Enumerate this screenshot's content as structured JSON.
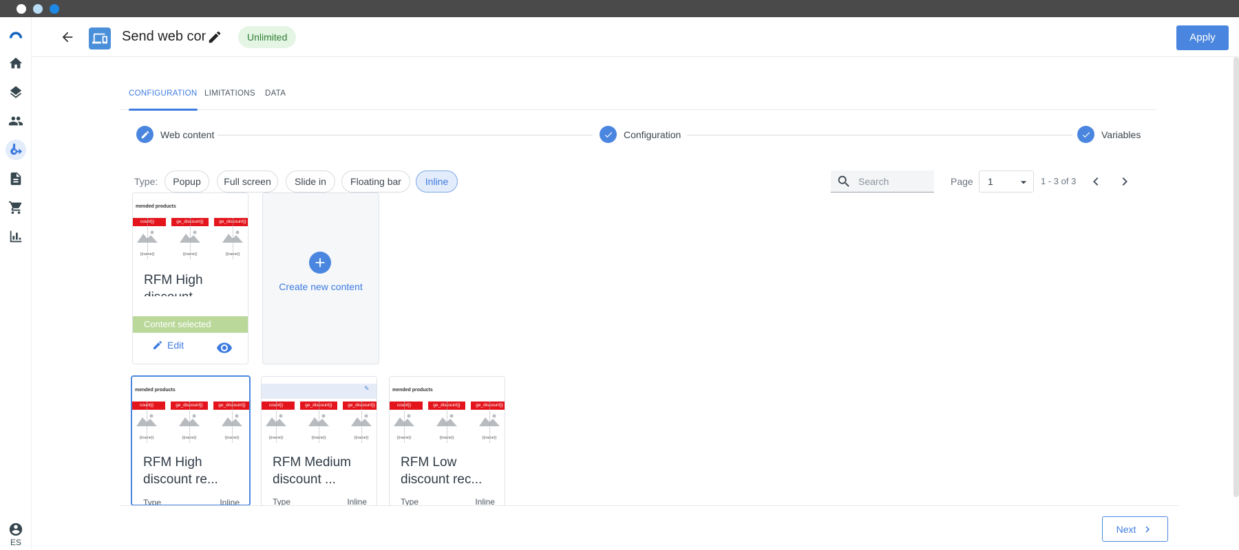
{
  "window": {
    "controls": [
      "close",
      "minimize",
      "maximize"
    ]
  },
  "rail": {
    "items": [
      {
        "icon": "logo-arc-icon"
      },
      {
        "icon": "home-icon"
      },
      {
        "icon": "layers-icon"
      },
      {
        "icon": "people-icon"
      },
      {
        "icon": "flow-branch-icon",
        "active": true
      },
      {
        "icon": "document-icon"
      },
      {
        "icon": "cart-icon"
      },
      {
        "icon": "bar-chart-icon"
      }
    ],
    "user_icon": "account-circle-icon",
    "language": "ES"
  },
  "header": {
    "title": "Send web content",
    "badge": "Unlimited",
    "apply_label": "Apply"
  },
  "tabs": [
    {
      "label": "CONFIGURATION",
      "active": true
    },
    {
      "label": "LIMITATIONS",
      "active": false
    },
    {
      "label": "DATA",
      "active": false
    }
  ],
  "stepper": {
    "steps": [
      {
        "label": "Web content",
        "icon": "pencil-icon"
      },
      {
        "label": "Configuration",
        "icon": "check-icon"
      },
      {
        "label": "Variables",
        "icon": "check-icon"
      }
    ]
  },
  "filters": {
    "type_label": "Type:",
    "chips": [
      {
        "label": "Popup",
        "active": false
      },
      {
        "label": "Full screen",
        "active": false
      },
      {
        "label": "Slide in",
        "active": false
      },
      {
        "label": "Floating bar",
        "active": false
      },
      {
        "label": "Inline",
        "active": true
      }
    ],
    "search_placeholder": "Search",
    "page_label": "Page",
    "page_value": "1",
    "range": "1 - 3 of 3"
  },
  "selected_card": {
    "thumb_header": "mended products",
    "title": "RFM High discount",
    "status": "Content selected",
    "edit_label": "Edit"
  },
  "new_card": {
    "label": "Create new content"
  },
  "thumb": {
    "red_labels": [
      "count}}",
      "ge_discount}}",
      "ge_discount}}",
      "ge_discou"
    ],
    "name_labels": [
      "{{name}}",
      "{{name}}",
      "{{name}}",
      "{{name}}"
    ]
  },
  "cards": [
    {
      "title_line1": "RFM High",
      "title_line2": "discount re...",
      "meta_key": "Type",
      "meta_value": "Inline",
      "thumb_header": "mended products"
    },
    {
      "title_line1": "RFM Medium",
      "title_line2": "discount ...",
      "meta_key": "Type",
      "meta_value": "Inline",
      "thumb_header": ""
    },
    {
      "title_line1": "RFM Low",
      "title_line2": "discount rec...",
      "meta_key": "Type",
      "meta_value": "Inline",
      "thumb_header": "mended products"
    }
  ],
  "footer": {
    "next_label": "Next"
  }
}
